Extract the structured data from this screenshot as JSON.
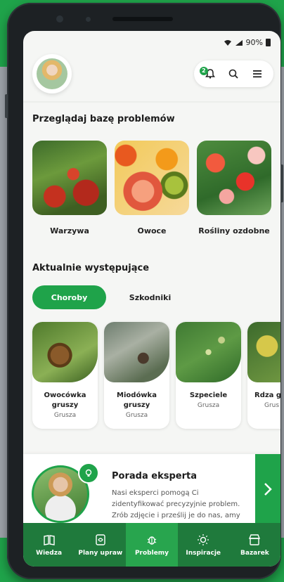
{
  "status": {
    "battery": "90%"
  },
  "header": {
    "notification_count": "2"
  },
  "sections": {
    "browse_title": "Przeglądaj bazę problemów",
    "current_title": "Aktualnie występujące"
  },
  "categories": [
    {
      "label": "Warzywa"
    },
    {
      "label": "Owoce"
    },
    {
      "label": "Rośliny ozdobne"
    }
  ],
  "tabs": [
    {
      "label": "Choroby",
      "active": true
    },
    {
      "label": "Szkodniki",
      "active": false
    }
  ],
  "problems": [
    {
      "name": "Owocówka gruszy",
      "host": "Grusza"
    },
    {
      "name": "Miodówka gruszy",
      "host": "Grusza"
    },
    {
      "name": "Szpeciele",
      "host": "Grusza"
    },
    {
      "name": "Rdza g",
      "host": "Grus"
    }
  ],
  "expert": {
    "title": "Porada eksperta",
    "text": "Nasi eksperci pomogą Ci zidentyfikować precyzyjnie problem. Zrób zdjęcie i prześlij je do nas, amy"
  },
  "nav": [
    {
      "label": "Wiedza",
      "icon": "book-icon",
      "active": false
    },
    {
      "label": "Plany upraw",
      "icon": "plan-icon",
      "active": false
    },
    {
      "label": "Problemy",
      "icon": "bug-icon",
      "active": true
    },
    {
      "label": "Inspiracje",
      "icon": "sun-icon",
      "active": false
    },
    {
      "label": "Bazarek",
      "icon": "shop-icon",
      "active": false
    }
  ],
  "colors": {
    "accent": "#1fa34a",
    "nav_bg": "#1f7a3c",
    "nav_active": "#28a54e"
  }
}
